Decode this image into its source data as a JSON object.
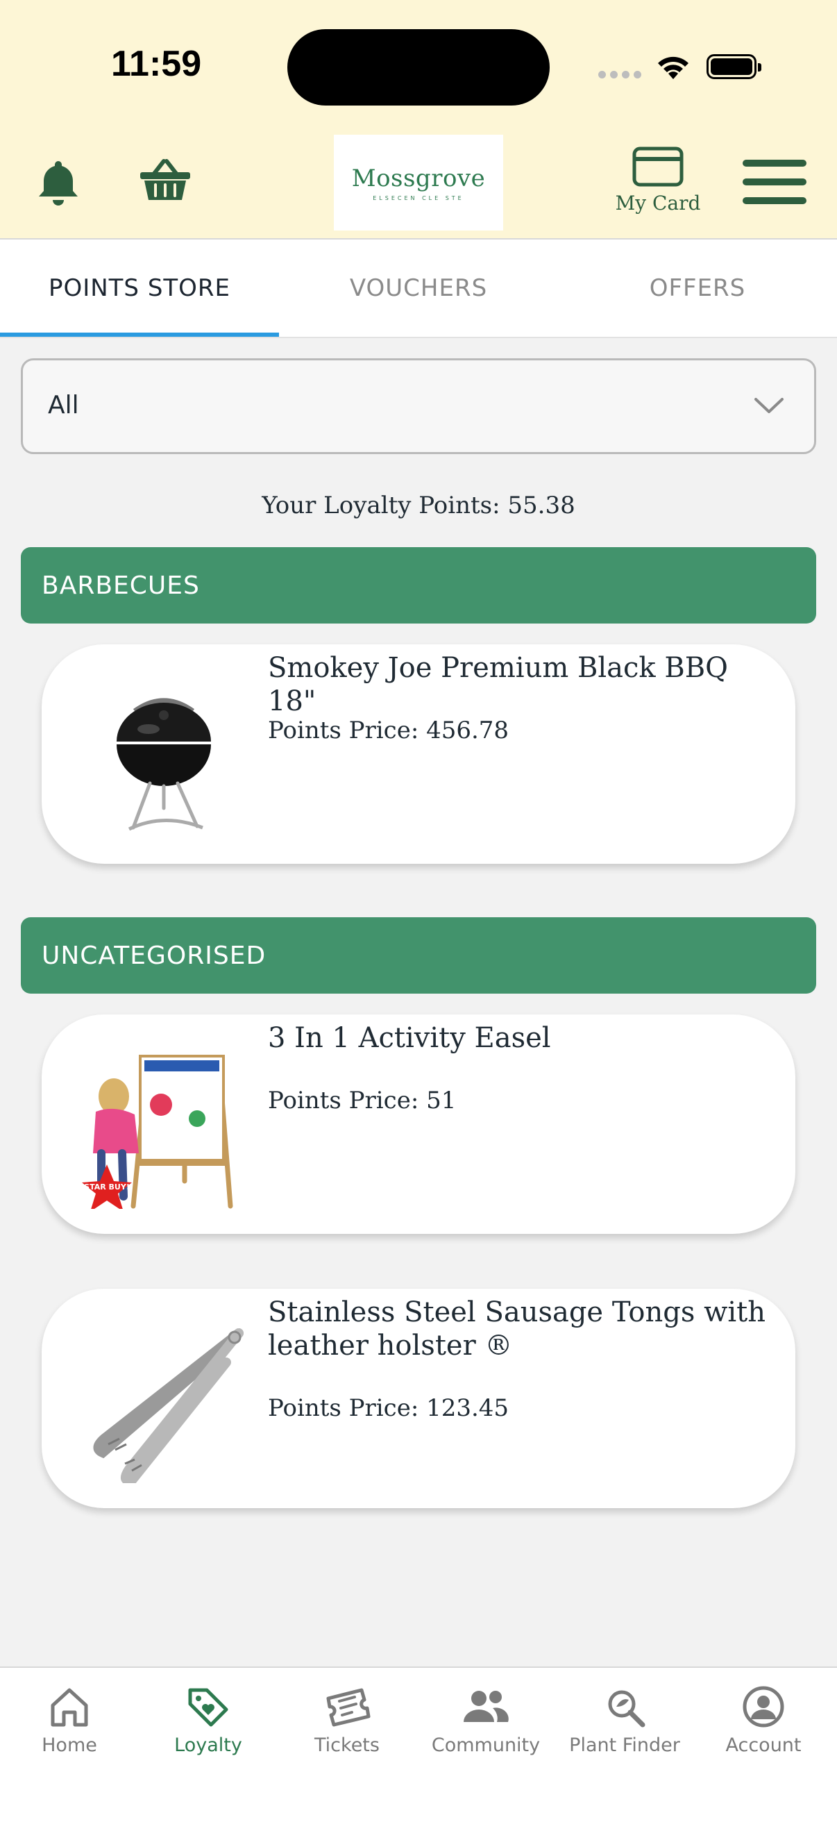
{
  "status_bar": {
    "time": "11:59"
  },
  "header": {
    "logo_name": "Mossgrove",
    "logo_tagline": "ELSECEN CLE STE",
    "my_card_label": "My Card",
    "icons": [
      "bell-icon",
      "basket-icon",
      "card-icon",
      "hamburger-menu-icon"
    ]
  },
  "tabs": [
    {
      "label": "POINTS STORE",
      "active": true
    },
    {
      "label": "VOUCHERS",
      "active": false
    },
    {
      "label": "OFFERS",
      "active": false
    }
  ],
  "filter": {
    "selected": "All"
  },
  "loyalty": {
    "text": "Your Loyalty Points: 55.38"
  },
  "categories": [
    {
      "name": "BARBECUES",
      "products": [
        {
          "title": "Smokey Joe Premium Black BBQ 18\"",
          "price": "Points Price: 456.78"
        }
      ]
    },
    {
      "name": "UNCATEGORISED",
      "products": [
        {
          "title": "3 In 1 Activity Easel",
          "price": "Points Price: 51",
          "badge": "STAR BUY!"
        },
        {
          "title": "Stainless Steel Sausage Tongs with leather holster ®",
          "price": "Points Price: 123.45"
        }
      ]
    }
  ],
  "colors": {
    "brand_green": "#42936c",
    "dark_green": "#2d5e3e",
    "header_bg": "#fdf6d6",
    "tab_accent": "#2b9be0"
  },
  "bottom_nav": [
    {
      "label": "Home",
      "icon": "home-icon"
    },
    {
      "label": "Loyalty",
      "icon": "tag-heart-icon",
      "active": true
    },
    {
      "label": "Tickets",
      "icon": "ticket-icon"
    },
    {
      "label": "Community",
      "icon": "people-icon"
    },
    {
      "label": "Plant Finder",
      "icon": "plant-search-icon"
    },
    {
      "label": "Account",
      "icon": "account-icon"
    }
  ]
}
